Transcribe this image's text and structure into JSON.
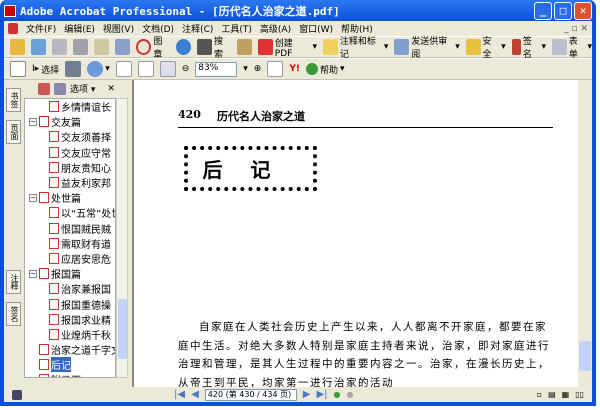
{
  "window": {
    "title": "Adobe Acrobat Professional - [历代名人治家之道.pdf]"
  },
  "menu": [
    "文件(F)",
    "编辑(E)",
    "视图(V)",
    "文档(D)",
    "注释(C)",
    "工具(T)",
    "高级(A)",
    "窗口(W)",
    "帮助(H)"
  ],
  "toolbar1": {
    "stamp": "图章",
    "search": "搜索",
    "create_pdf": "创建 PDF",
    "comment": "注释和标记",
    "review": "发送供审阅",
    "security": "安全",
    "sign": "签名",
    "forms": "表单"
  },
  "toolbar2": {
    "select": "选择",
    "zoom": "83%",
    "help": "帮助"
  },
  "side_tabs": [
    "书签",
    "页面",
    "注释",
    "签名"
  ],
  "panel": {
    "options": "选项"
  },
  "bookmarks": [
    {
      "label": "乡情情谊长",
      "level": 2
    },
    {
      "label": "交友篇",
      "level": 1
    },
    {
      "label": "交友须善择",
      "level": 2
    },
    {
      "label": "交友应守常",
      "level": 2
    },
    {
      "label": "朋友贵知心",
      "level": 2
    },
    {
      "label": "益友利家邦",
      "level": 2
    },
    {
      "label": "处世篇",
      "level": 1
    },
    {
      "label": "以“五常”处世",
      "level": 2
    },
    {
      "label": "恨国贼民贼",
      "level": 2
    },
    {
      "label": "需取财有道",
      "level": 2
    },
    {
      "label": "应居安思危",
      "level": 2
    },
    {
      "label": "报国篇",
      "level": 1
    },
    {
      "label": "治家兼报国",
      "level": 2
    },
    {
      "label": "报国重德操",
      "level": 2
    },
    {
      "label": "报国求业精",
      "level": 2
    },
    {
      "label": "业煌炳千秋",
      "level": 2
    },
    {
      "label": "治家之道千字文",
      "level": 0
    },
    {
      "label": "后记",
      "level": 0,
      "selected": true
    },
    {
      "label": "附录页",
      "level": 0
    }
  ],
  "page": {
    "number": "420",
    "running_title": "历代名人治家之道",
    "heading": "后记",
    "body": "自家庭在人类社会历史上产生以来，人人都离不开家庭，都要在家庭中生活。对绝大多数人特别是家庭主持者来说，治家，即对家庭进行治理和管理，是其人生过程中的重要内容之一。治家，在漫长历史上，从帝王到平民，均家第一进行治家的活动"
  },
  "status": {
    "page_field": "420 (第 430 / 434 页)"
  }
}
